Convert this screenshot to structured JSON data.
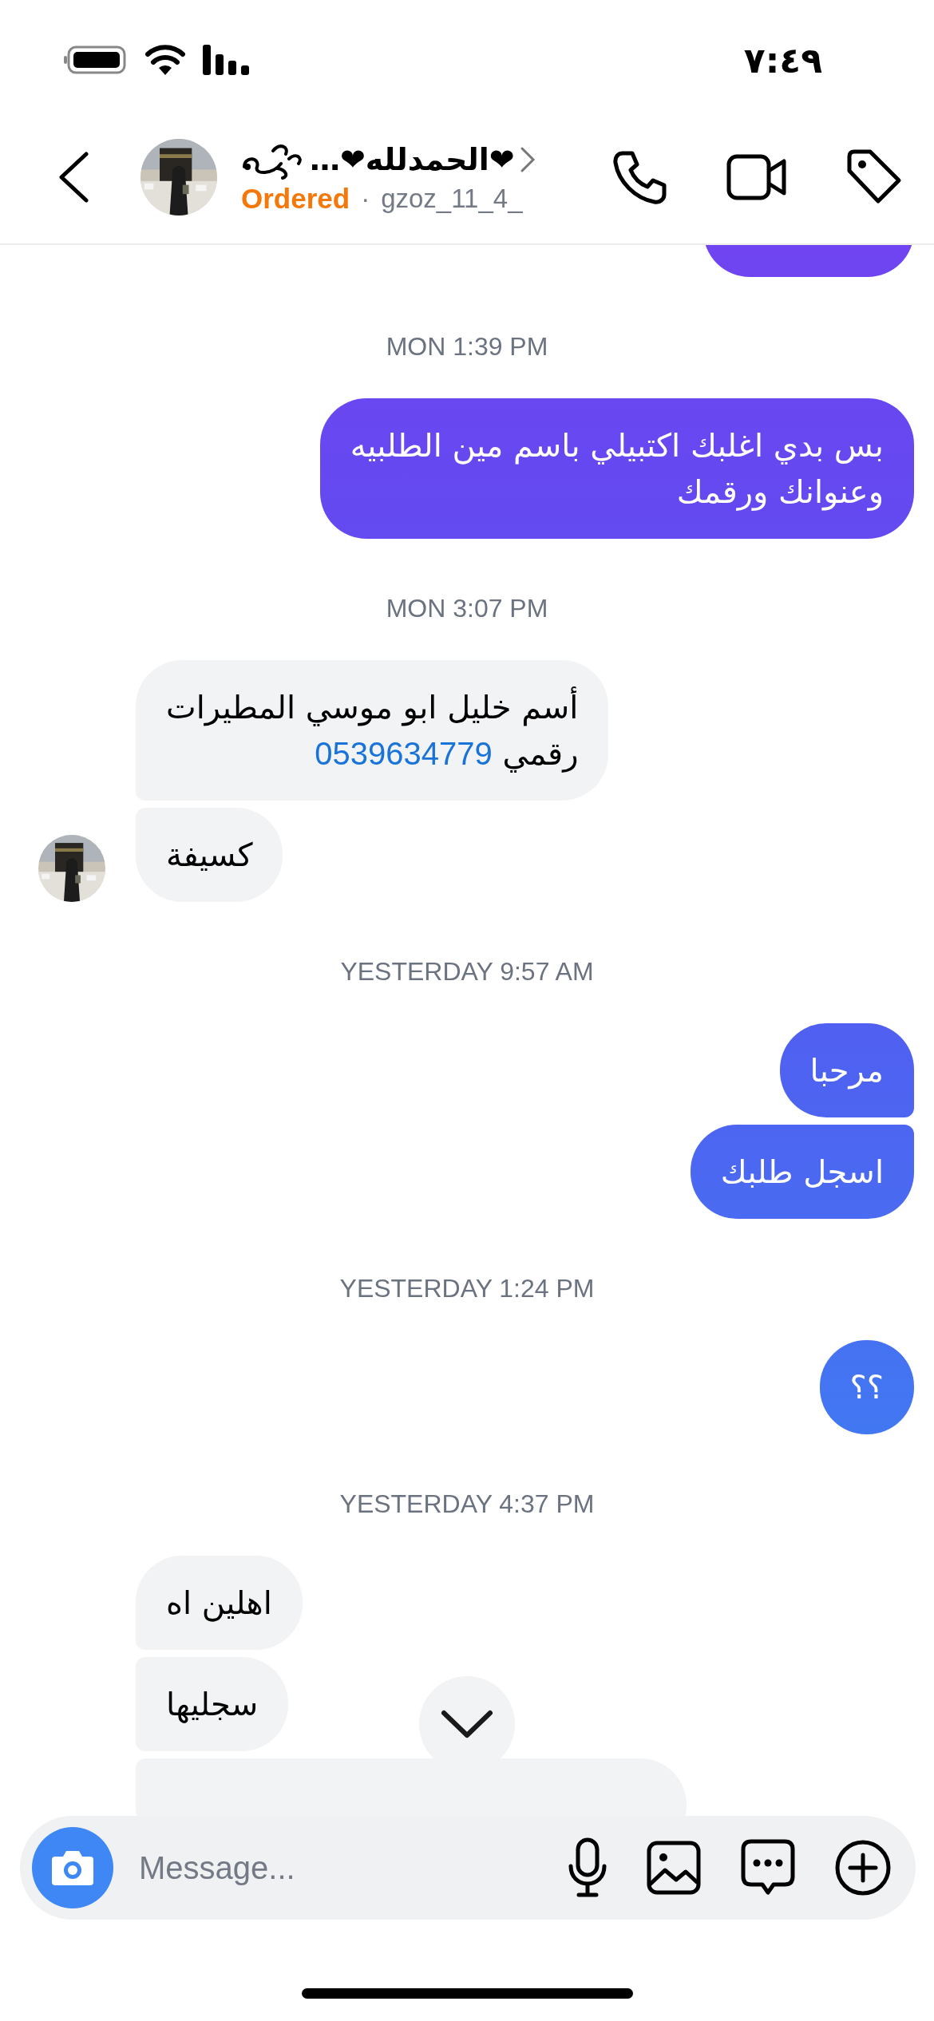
{
  "status_bar": {
    "time": "٧:٤٩"
  },
  "header": {
    "name": "…❤الحمدلله❤",
    "status": "Ordered",
    "separator": "·",
    "username": "gzoz_11_4_"
  },
  "messages": [
    {
      "kind": "clipped_sent"
    },
    {
      "kind": "timestamp",
      "text": "MON 1:39 PM"
    },
    {
      "kind": "sent",
      "text": "بس بدي اغلبك اكتبيلي باسم مين الطلبيه\nوعنوانك ورقمك"
    },
    {
      "kind": "timestamp",
      "text": "MON 3:07 PM"
    },
    {
      "kind": "received",
      "text": "أسم خليل ابو موسي المطيرات\nرقمي ",
      "link": "0539634779",
      "avatar": false
    },
    {
      "kind": "received",
      "text": "كسيفة",
      "avatar": true
    },
    {
      "kind": "timestamp",
      "text": "YESTERDAY 9:57 AM"
    },
    {
      "kind": "sent",
      "text": "مرحبا"
    },
    {
      "kind": "sent",
      "text": "اسجل طلبك"
    },
    {
      "kind": "timestamp",
      "text": "YESTERDAY 1:24 PM"
    },
    {
      "kind": "sent",
      "text": "؟؟"
    },
    {
      "kind": "timestamp",
      "text": "YESTERDAY 4:37 PM"
    },
    {
      "kind": "received",
      "text": "اهلين اه",
      "avatar": false
    },
    {
      "kind": "received",
      "text": "سجليها",
      "avatar": false
    },
    {
      "kind": "clipped_received"
    }
  ],
  "composer": {
    "placeholder": "Message..."
  }
}
